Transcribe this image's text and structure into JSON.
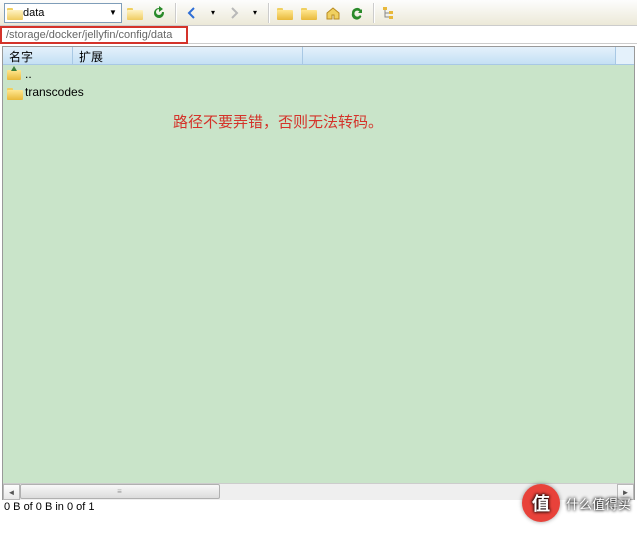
{
  "toolbar": {
    "address_value": "data"
  },
  "path": "/storage/docker/jellyfin/config/data",
  "columns": {
    "name": "名字",
    "ext": "扩展"
  },
  "rows": {
    "up": "..",
    "folder1": "transcodes"
  },
  "annotation": "路径不要弄错，否则无法转码。",
  "status": "0 B of 0 B in 0 of 1",
  "watermark": {
    "badge": "值",
    "text": "什么值得买"
  }
}
